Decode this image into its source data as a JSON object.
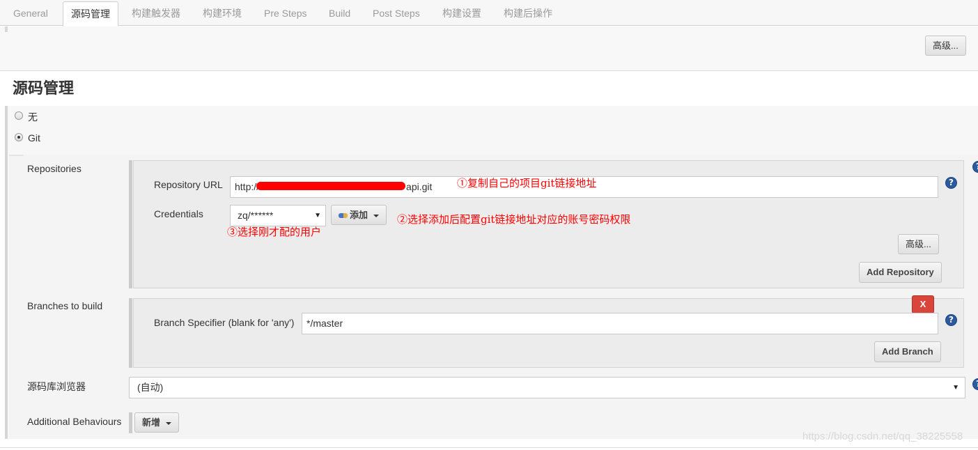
{
  "tabs": [
    {
      "label": "General"
    },
    {
      "label": "源码管理"
    },
    {
      "label": "构建触发器"
    },
    {
      "label": "构建环境"
    },
    {
      "label": "Pre Steps"
    },
    {
      "label": "Build"
    },
    {
      "label": "Post Steps"
    },
    {
      "label": "构建设置"
    },
    {
      "label": "构建后操作"
    }
  ],
  "active_tab": "源码管理",
  "general": {
    "advanced_label": "高级..."
  },
  "scm": {
    "title": "源码管理",
    "options": [
      {
        "label": "无",
        "selected": false
      },
      {
        "label": "Git",
        "selected": true
      }
    ]
  },
  "repositories": {
    "label": "Repositories",
    "url_label": "Repository URL",
    "url_prefix": "http://",
    "url_suffix": "api.git",
    "credentials_label": "Credentials",
    "credentials_value": "zq/******",
    "add_label": "添加",
    "advanced_label": "高级...",
    "add_repository_label": "Add Repository"
  },
  "branches": {
    "label": "Branches to build",
    "delete_label": "X",
    "specifier_label": "Branch Specifier (blank for 'any')",
    "specifier_value": "*/master",
    "add_branch_label": "Add Branch"
  },
  "browser": {
    "label": "源码库浏览器",
    "value": "(自动)"
  },
  "behaviours": {
    "label": "Additional Behaviours",
    "add_label": "新增"
  },
  "annotations": {
    "a1": "①复制自己的项目git链接地址",
    "a2": "②选择添加后配置git链接地址对应的账号密码权限",
    "a3": "③选择刚才配的用户"
  },
  "watermark": "https://blog.csdn.net/qq_38225558",
  "colors": {
    "accent_red": "#ff0000",
    "help_blue": "#2c5aa0",
    "delete_red": "#d9453a"
  }
}
